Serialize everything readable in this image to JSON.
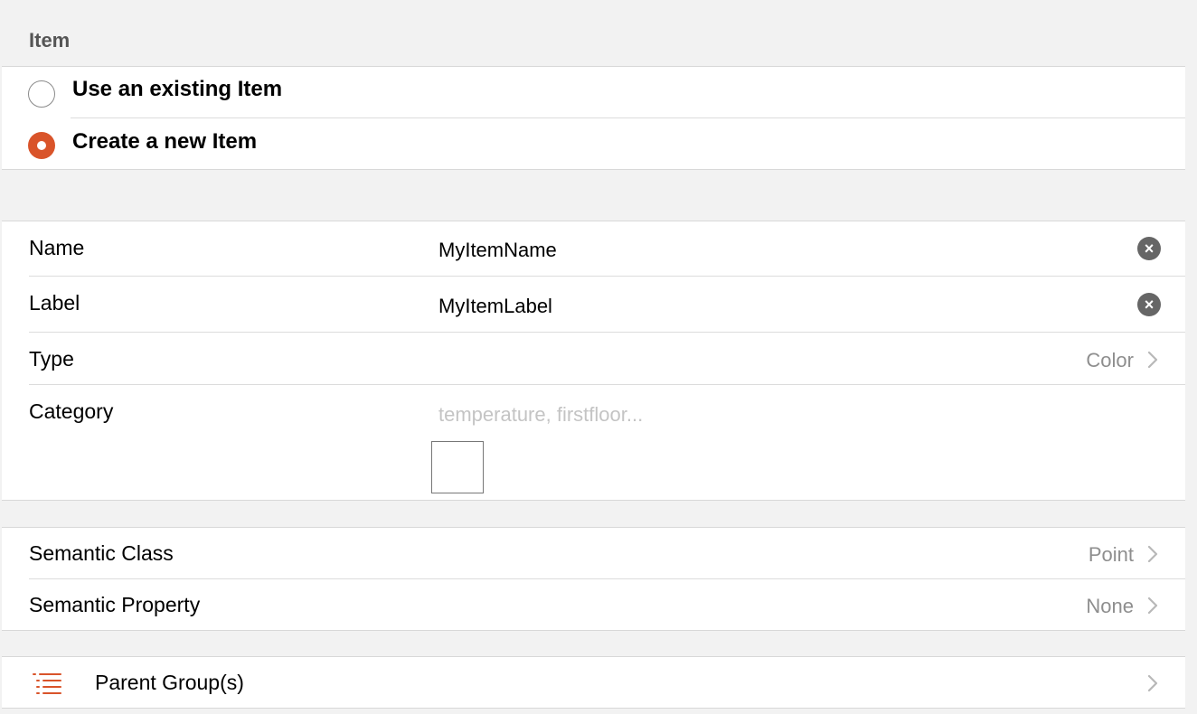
{
  "section": {
    "title": "Item"
  },
  "item_mode": {
    "options": [
      {
        "label": "Use an existing Item",
        "selected": false
      },
      {
        "label": "Create a new Item",
        "selected": true
      }
    ]
  },
  "details": {
    "name": {
      "label": "Name",
      "value": "MyItemName"
    },
    "label": {
      "label": "Label",
      "value": "MyItemLabel"
    },
    "type": {
      "label": "Type",
      "value": "Color"
    },
    "category": {
      "label": "Category",
      "placeholder": "temperature, firstfloor..."
    }
  },
  "semantics": {
    "class": {
      "label": "Semantic Class",
      "value": "Point"
    },
    "property": {
      "label": "Semantic Property",
      "value": "None"
    }
  },
  "groups": {
    "label": "Parent Group(s)"
  },
  "colors": {
    "accent": "#d9542a",
    "background": "#f2f2f2",
    "secondary_text": "#8e8e8e",
    "placeholder": "#c4c4c4",
    "clear_icon": "#666666"
  },
  "icons": {
    "clear": "close-circle-icon",
    "chevron": "chevron-right-icon",
    "list": "list-icon"
  }
}
